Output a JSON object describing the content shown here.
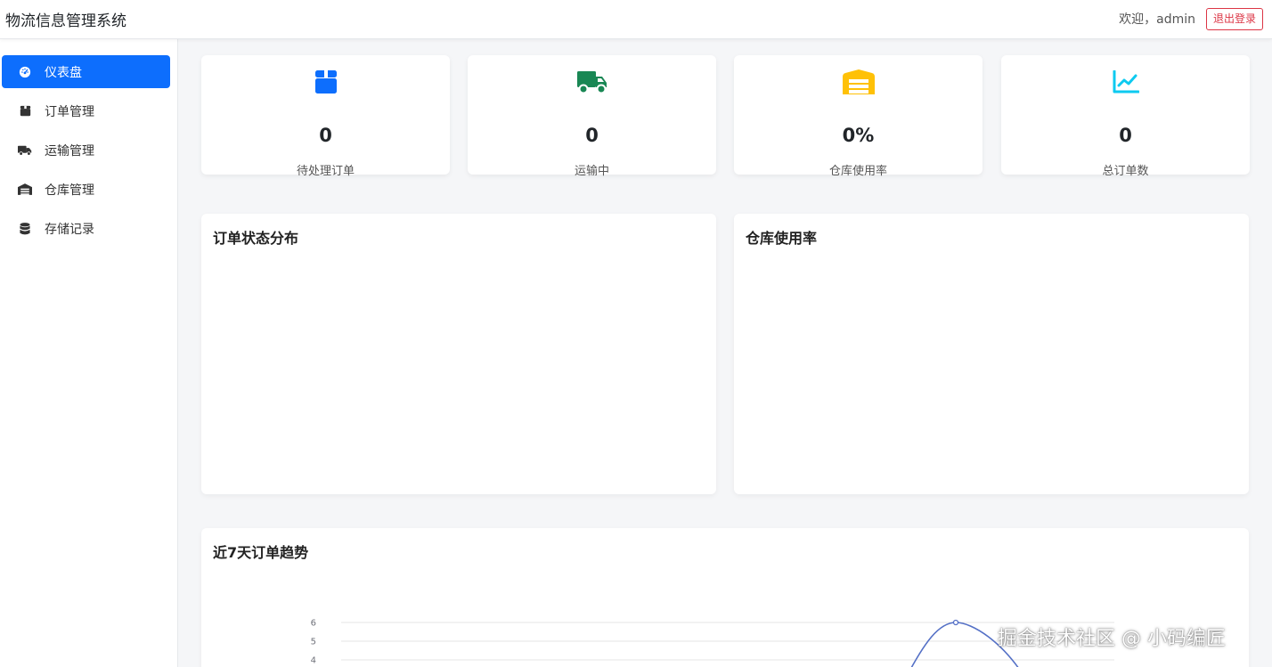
{
  "header": {
    "app_title": "物流信息管理系统",
    "welcome_text": "欢迎，admin",
    "logout_label": "退出登录"
  },
  "sidebar": {
    "items": [
      {
        "label": "仪表盘",
        "icon": "dashboard-icon",
        "active": true
      },
      {
        "label": "订单管理",
        "icon": "box-icon",
        "active": false
      },
      {
        "label": "运输管理",
        "icon": "truck-icon",
        "active": false
      },
      {
        "label": "仓库管理",
        "icon": "warehouse-icon",
        "active": false
      },
      {
        "label": "存储记录",
        "icon": "database-icon",
        "active": false
      }
    ]
  },
  "stats": [
    {
      "value": "0",
      "label": "待处理订单",
      "icon": "box-icon",
      "color": "#0d6efd"
    },
    {
      "value": "0",
      "label": "运输中",
      "icon": "truck-icon",
      "color": "#198754"
    },
    {
      "value": "0%",
      "label": "仓库使用率",
      "icon": "warehouse-icon",
      "color": "#ffc107"
    },
    {
      "value": "0",
      "label": "总订单数",
      "icon": "chart-line-icon",
      "color": "#0dcaf0"
    }
  ],
  "panels": {
    "order_status": {
      "title": "订单状态分布"
    },
    "warehouse_usage": {
      "title": "仓库使用率"
    },
    "trend": {
      "title": "近7天订单趋势"
    }
  },
  "chart_data": {
    "type": "line",
    "title": "近7天订单趋势",
    "y_ticks": [
      4,
      5,
      6
    ],
    "series": [
      {
        "color": "#5470c6",
        "peak_value": 6
      }
    ]
  },
  "watermark": "掘金技术社区 @ 小码编匠",
  "colors": {
    "primary": "#0d6efd",
    "danger": "#dc3545",
    "success": "#198754",
    "warning": "#ffc107",
    "info": "#0dcaf0",
    "line": "#5470c6"
  }
}
